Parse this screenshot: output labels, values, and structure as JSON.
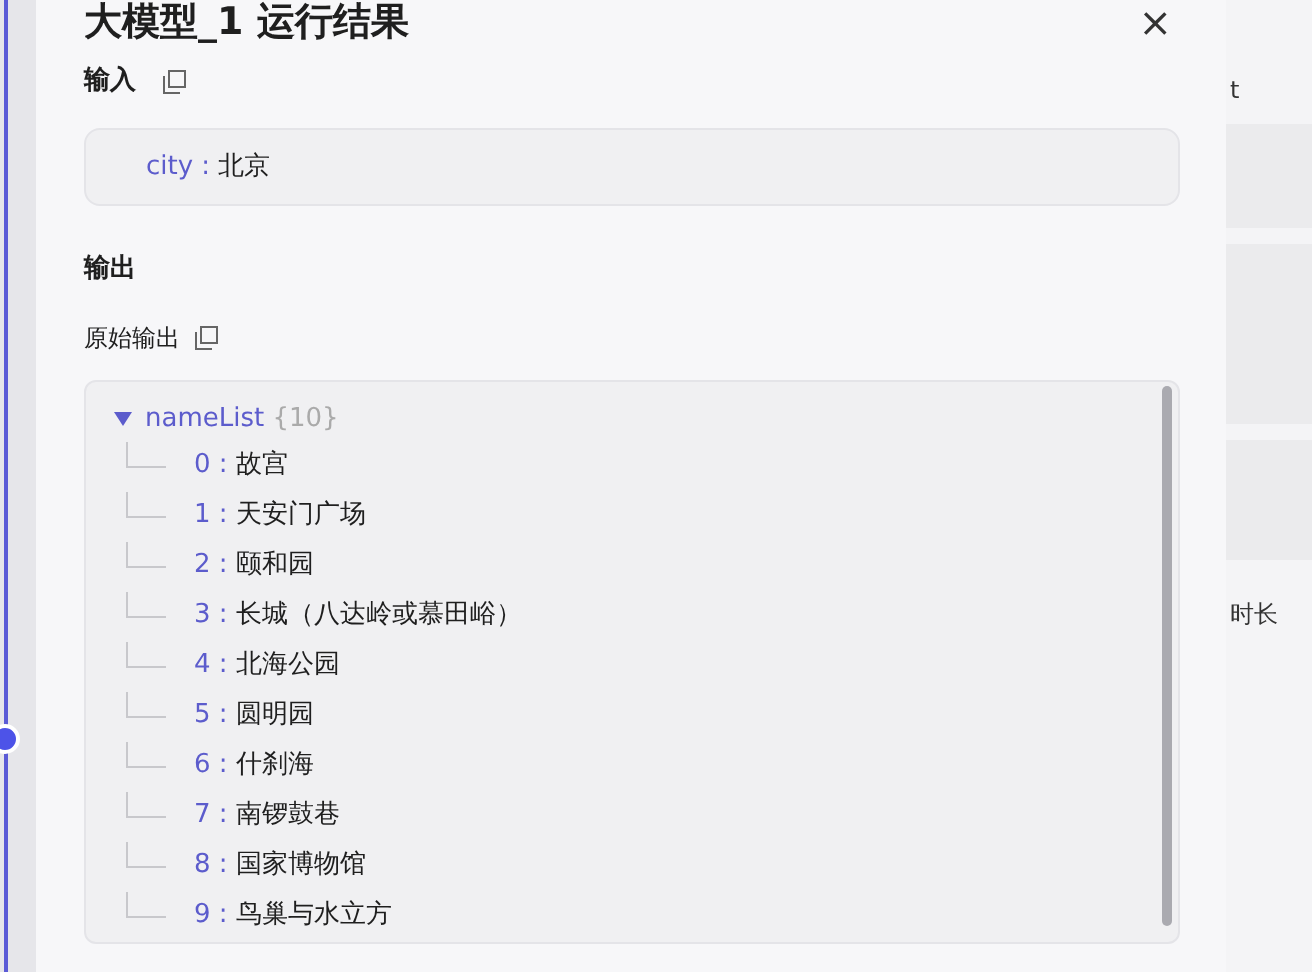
{
  "dialog": {
    "title": "大模型_1 运行结果",
    "close": "×"
  },
  "input": {
    "label": "输入",
    "separator": ":",
    "fields": [
      {
        "key": "city",
        "value": "北京"
      }
    ]
  },
  "output": {
    "label": "输出",
    "raw_label": "原始输出",
    "tree": {
      "key": "nameList",
      "separator": ":",
      "count": "{10}",
      "expanded": true,
      "children": [
        {
          "key": "0",
          "value": "故宫"
        },
        {
          "key": "1",
          "value": "天安门广场"
        },
        {
          "key": "2",
          "value": "颐和园"
        },
        {
          "key": "3",
          "value": "长城（八达岭或慕田峪）"
        },
        {
          "key": "4",
          "value": "北海公园"
        },
        {
          "key": "5",
          "value": "圆明园"
        },
        {
          "key": "6",
          "value": "什刹海"
        },
        {
          "key": "7",
          "value": "南锣鼓巷"
        },
        {
          "key": "8",
          "value": "国家博物馆"
        },
        {
          "key": "9",
          "value": "鸟巢与水立方"
        }
      ]
    }
  },
  "background": {
    "texts": [
      "t",
      "时长"
    ]
  }
}
